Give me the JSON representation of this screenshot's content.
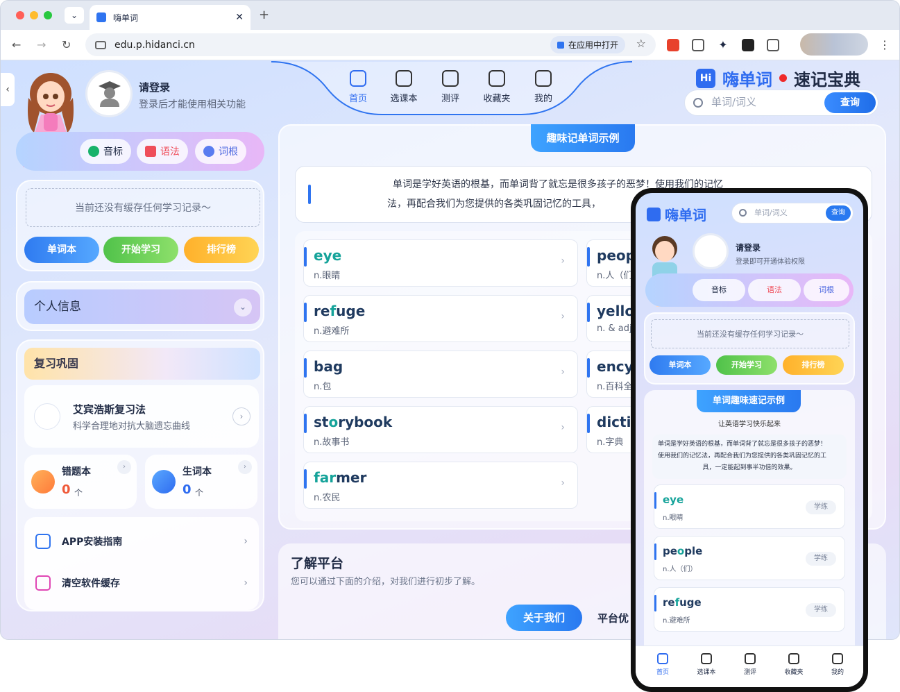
{
  "browser": {
    "tab_title": "嗨单词",
    "url": "edu.p.hidanci.cn",
    "open_in_app": "在应用中打开"
  },
  "user": {
    "login_title": "请登录",
    "login_sub": "登录后才能使用相关功能"
  },
  "chips": [
    "音标",
    "语法",
    "词根"
  ],
  "history": {
    "empty": "当前还没有缓存任何学习记录～",
    "buttons": [
      "单词本",
      "开始学习",
      "排行榜"
    ]
  },
  "personal_info": "个人信息",
  "review": {
    "title": "复习巩固",
    "ebbinghaus_title": "艾宾浩斯复习法",
    "ebbinghaus_sub": "科学合理地对抗大脑遗忘曲线",
    "wrong_book": {
      "label": "错题本",
      "count": "0",
      "unit": "个"
    },
    "new_words": {
      "label": "生词本",
      "count": "0",
      "unit": "个"
    }
  },
  "links": [
    "APP安装指南",
    "清空软件缓存"
  ],
  "nav": [
    "首页",
    "选课本",
    "测评",
    "收藏夹",
    "我的"
  ],
  "brand": {
    "name": "嗨单词",
    "slogan": "速记宝典"
  },
  "search": {
    "placeholder": "单词/词义",
    "button": "查询"
  },
  "example": {
    "ribbon": "趣味记单词示例",
    "intro_line1": "单词是学好英语的根基，而单词背了就忘是很多孩子的恶梦！使用我们的记忆",
    "intro_line2": "法，再配合我们为您提供的各类巩固记忆的工具，",
    "words_left": [
      {
        "pre": "",
        "hl": "eye",
        "post": "",
        "meaning": "n.眼睛"
      },
      {
        "pre": "re",
        "hl": "f",
        "post": "uge",
        "meaning": "n.避难所"
      },
      {
        "pre": "",
        "hl": "bag",
        "post": "",
        "meaning": "n.包"
      },
      {
        "pre": "st",
        "hl": "o",
        "post": "rybook",
        "meaning": "n.故事书"
      },
      {
        "pre": "",
        "hl": "far",
        "post": "mer",
        "meaning": "n.农民"
      }
    ],
    "words_right": [
      {
        "word": "peop",
        "meaning": "n.人（们"
      },
      {
        "word": "yellov",
        "meaning": "n. & adj"
      },
      {
        "word": "ency",
        "meaning": "n.百科全"
      },
      {
        "word": "dictio",
        "meaning": "n.字典"
      }
    ]
  },
  "about": {
    "title": "了解平台",
    "sub": "您可以通过下面的介绍，对我们进行初步了解。",
    "btn1": "关于我们",
    "btn2": "平台优"
  },
  "phone": {
    "brand": "嗨单词",
    "search_placeholder": "单词/词义",
    "search_btn": "查询",
    "login_title": "请登录",
    "login_sub": "登录即可开通体验权限",
    "chips": [
      "音标",
      "语法",
      "词根"
    ],
    "empty": "当前还没有缓存任何学习记录～",
    "buttons": [
      "单词本",
      "开始学习",
      "排行榜"
    ],
    "ribbon": "单词趣味速记示例",
    "sub": "让英语学习快乐起来",
    "intro1": "单词是学好英语的根基，而单词背了就忘是很多孩子的恶梦！",
    "intro2": "使用我们的记忆法，再配合我们为您提供的各类巩固记忆的工",
    "intro3": "具，一定能起到事半功倍的效果。",
    "words": [
      {
        "pre": "",
        "hl": "eye",
        "post": "",
        "meaning": "n.眼睛"
      },
      {
        "pre": "pe",
        "hl": "o",
        "post": "ple",
        "meaning": "n.人（们）"
      },
      {
        "pre": "re",
        "hl": "f",
        "post": "uge",
        "meaning": "n.避难所"
      }
    ],
    "practice": "学练",
    "tabs": [
      "首页",
      "选课本",
      "测评",
      "收藏夹",
      "我的"
    ]
  }
}
